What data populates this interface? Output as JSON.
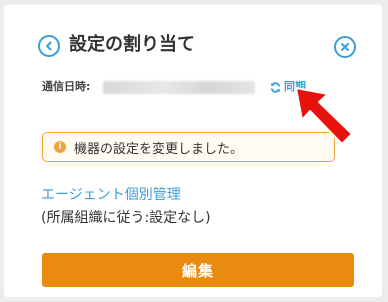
{
  "header": {
    "title": "設定の割り当て",
    "back_icon": "chevron-left-icon",
    "close_icon": "close-icon"
  },
  "sync": {
    "label": "通信日時:",
    "link_label": "同期",
    "link_icon": "refresh-icon"
  },
  "notice": {
    "icon": "info-icon",
    "icon_glyph": "i",
    "message": "機器の設定を変更しました。"
  },
  "agent": {
    "link_label": "エージェント個別管理",
    "note": "(所属組織に従う:設定なし)"
  },
  "actions": {
    "edit_label": "編集"
  },
  "colors": {
    "accent": "#3a9fd8",
    "warning": "#f0a53a",
    "primary_button": "#e88b0f",
    "pointer_arrow": "#e8120c"
  }
}
